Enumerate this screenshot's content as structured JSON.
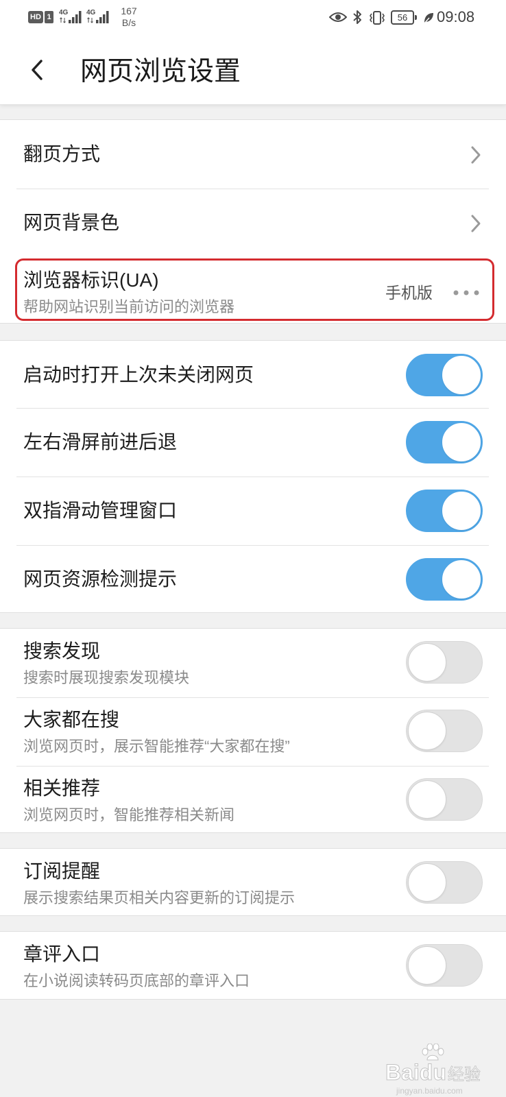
{
  "status_bar": {
    "hd_badge": "HD",
    "sim_slot": "1",
    "signal_1": {
      "label": "4G",
      "bars": 4
    },
    "signal_2": {
      "label": "4G",
      "bars": 4
    },
    "net_speed_value": "167",
    "net_speed_unit": "B/s",
    "battery_level": "56",
    "time": "09:08",
    "icons": [
      "eye-icon",
      "bluetooth-icon",
      "vibrate-icon",
      "battery-icon",
      "leaf-icon"
    ]
  },
  "header": {
    "title": "网页浏览设置",
    "back_icon": "chevron-left-icon"
  },
  "groups": [
    {
      "items": [
        {
          "title": "翻页方式",
          "icon": "chevron-right-icon"
        },
        {
          "title": "网页背景色",
          "icon": "chevron-right-icon"
        },
        {
          "title": "浏览器标识(UA)",
          "subtitle": "帮助网站识别当前访问的浏览器",
          "value": "手机版",
          "icon": "more-dots-icon",
          "highlighted": true
        }
      ]
    },
    {
      "items": [
        {
          "title": "启动时打开上次未关闭网页",
          "toggle_on": true
        },
        {
          "title": "左右滑屏前进后退",
          "toggle_on": true
        },
        {
          "title": "双指滑动管理窗口",
          "toggle_on": true
        },
        {
          "title": "网页资源检测提示",
          "toggle_on": true
        }
      ]
    },
    {
      "items": [
        {
          "title": "搜索发现",
          "subtitle": "搜索时展现搜索发现模块",
          "toggle_on": false
        },
        {
          "title": "大家都在搜",
          "subtitle": "浏览网页时，展示智能推荐“大家都在搜”",
          "toggle_on": false
        },
        {
          "title": "相关推荐",
          "subtitle": "浏览网页时，智能推荐相关新闻",
          "toggle_on": false
        }
      ]
    },
    {
      "items": [
        {
          "title": "订阅提醒",
          "subtitle": "展示搜索结果页相关内容更新的订阅提示",
          "toggle_on": false
        }
      ]
    },
    {
      "items": [
        {
          "title": "章评入口",
          "subtitle": "在小说阅读转码页底部的章评入口",
          "toggle_on": false
        }
      ]
    }
  ],
  "colors": {
    "page_background": "#f1f1f1",
    "toggle_on": "#4fa6e6",
    "toggle_off": "#e3e3e3",
    "highlight_border": "#d42b2f"
  },
  "watermark": {
    "brand_1": "Bai",
    "brand_2": "du",
    "brand_cn": "经验",
    "url": "jingyan.baidu.com",
    "logo_icon": "paw-icon"
  }
}
